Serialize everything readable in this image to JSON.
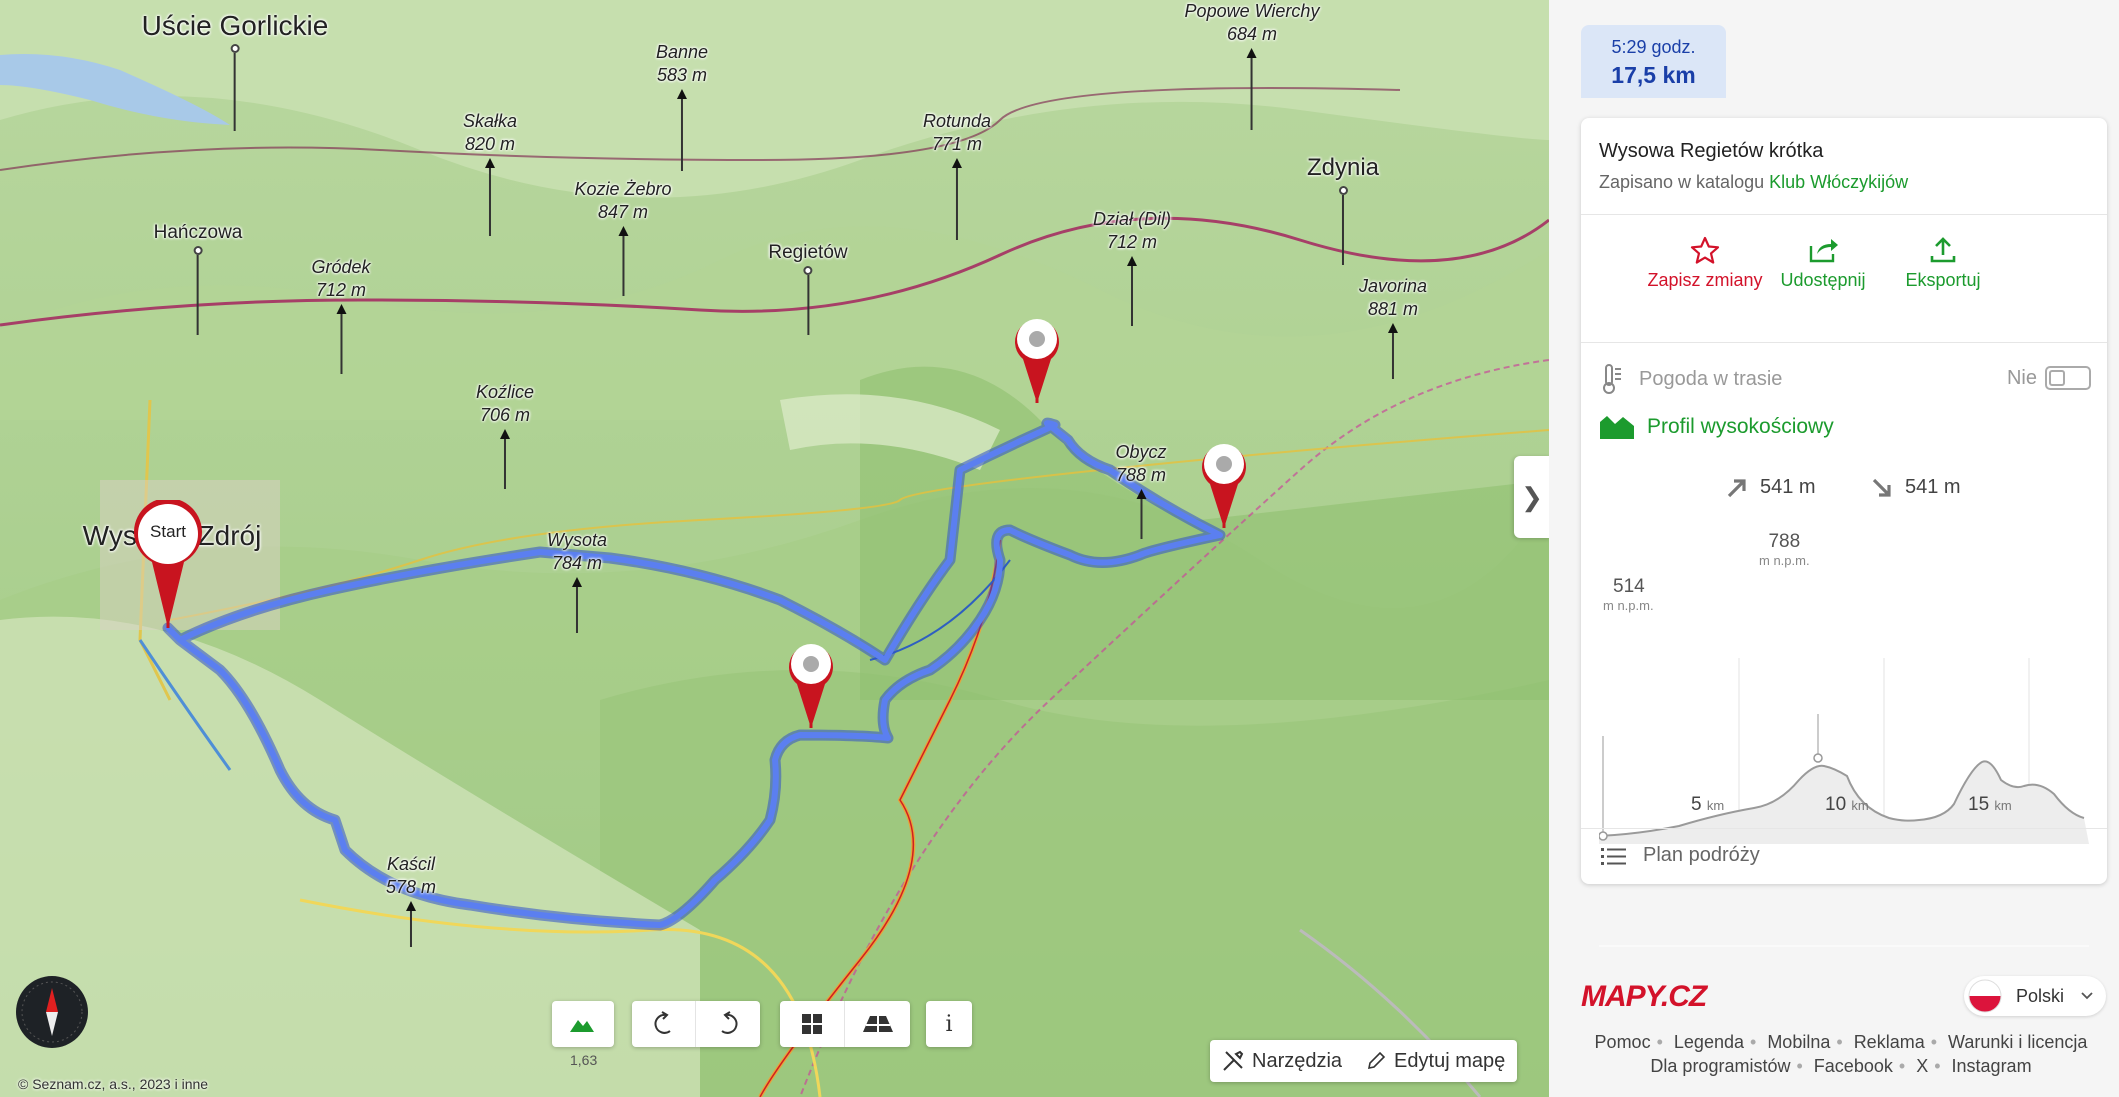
{
  "map": {
    "towns": [
      {
        "id": "uscie",
        "label": "Uście Gorlickie"
      },
      {
        "id": "hanczowa",
        "label": "Hańczowa"
      },
      {
        "id": "regietow",
        "label": "Regietów"
      },
      {
        "id": "zdynia",
        "label": "Zdynia"
      },
      {
        "id": "wysowa",
        "label": "Wysowa-Zdrój"
      }
    ],
    "peaks": [
      {
        "id": "popowe",
        "name": "Popowe Wierchy",
        "elev": "684 m"
      },
      {
        "id": "banne",
        "name": "Banne",
        "elev": "583 m"
      },
      {
        "id": "skalka",
        "name": "Skałka",
        "elev": "820 m"
      },
      {
        "id": "rotunda",
        "name": "Rotunda",
        "elev": "771 m"
      },
      {
        "id": "kozie",
        "name": "Kozie Żebro",
        "elev": "847 m"
      },
      {
        "id": "grodek",
        "name": "Gródek",
        "elev": "712 m"
      },
      {
        "id": "dzial",
        "name": "Dział (Dil)",
        "elev": "712 m"
      },
      {
        "id": "javorina",
        "name": "Javorina",
        "elev": "881 m"
      },
      {
        "id": "kozlice",
        "name": "Koźlice",
        "elev": "706 m"
      },
      {
        "id": "obycz",
        "name": "Obycz",
        "elev": "788 m"
      },
      {
        "id": "wysota",
        "name": "Wysota",
        "elev": "784 m"
      },
      {
        "id": "kascil",
        "name": "Kaścil",
        "elev": "578 m"
      }
    ],
    "start_label": "Start",
    "zoom_level": "1,63",
    "copyright": "© Seznam.cz, a.s., 2023 i inne",
    "tools": {
      "tools_label": "Narzędzia",
      "edit_label": "Edytuj mapę"
    },
    "info_label": "i",
    "collapse_glyph": "❯",
    "colors": {
      "route": "#4a6fe0",
      "pin": "#c8141f",
      "accent": "#1c9b2e",
      "link_blue": "#1a3fa8"
    }
  },
  "panel": {
    "duration": "5:29 godz.",
    "distance": "17,5 km",
    "route_title": "Wysowa Regietów krótka",
    "catalog_prefix": "Zapisano w katalogu",
    "catalog_link": "Klub Włóczykijów",
    "actions": [
      {
        "id": "save",
        "label": "Zapisz zmiany",
        "icon": "star-icon"
      },
      {
        "id": "share",
        "label": "Udostępnij",
        "icon": "share-icon"
      },
      {
        "id": "export",
        "label": "Eksportuj",
        "icon": "upload-icon"
      }
    ],
    "weather_label": "Pogoda w trasie",
    "weather_toggle": "Nie",
    "profile_label": "Profil wysokościowy",
    "ascent": "541 m",
    "descent": "541 m",
    "elev_start": "514",
    "elev_max": "788",
    "elev_unit": "m n.p.m.",
    "km_ticks": [
      {
        "value": "5",
        "unit": "km"
      },
      {
        "value": "10",
        "unit": "km"
      },
      {
        "value": "15",
        "unit": "km"
      }
    ],
    "plan_label": "Plan podróży"
  },
  "footer": {
    "logo": "MAPY.CZ",
    "language": "Polski",
    "links_row1": [
      "Pomoc",
      "Legenda",
      "Mobilna",
      "Reklama",
      "Warunki i licencja"
    ],
    "links_row2": [
      "Dla programistów",
      "Facebook",
      "X",
      "Instagram"
    ]
  }
}
